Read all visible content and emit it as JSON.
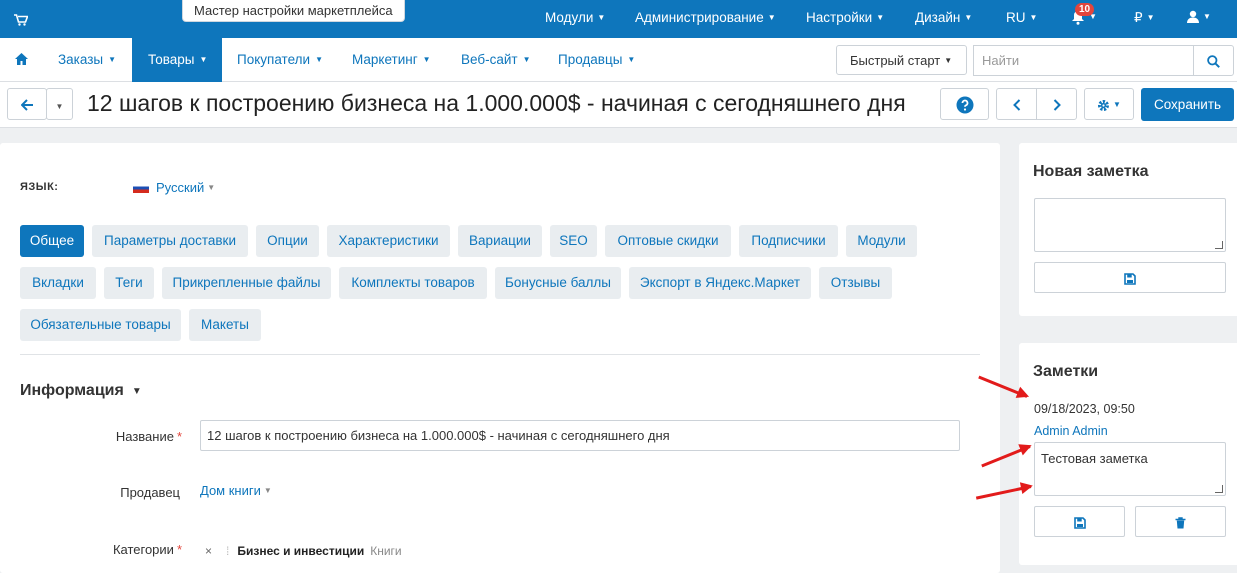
{
  "topbar": {
    "wizard": "Мастер настройки маркетплейса",
    "menus": [
      "Модули",
      "Администрирование",
      "Настройки",
      "Дизайн",
      "RU"
    ],
    "notifications": "10",
    "currency": "₽"
  },
  "nav": {
    "items": [
      "Заказы",
      "Товары",
      "Покупатели",
      "Маркетинг",
      "Веб-сайт",
      "Продавцы"
    ],
    "quick_start": "Быстрый старт",
    "search_placeholder": "Найти"
  },
  "title": {
    "text": "12 шагов к построению бизнеса на 1.000.000$ - начиная с сегодняшнего дня",
    "save": "Сохранить"
  },
  "form": {
    "lang_label": "ЯЗЫК:",
    "lang_value": "Русский",
    "tabs": [
      "Общее",
      "Параметры доставки",
      "Опции",
      "Характеристики",
      "Вариации",
      "SEO",
      "Оптовые скидки",
      "Подписчики",
      "Модули",
      "Вкладки",
      "Теги",
      "Прикрепленные файлы",
      "Комплекты товаров",
      "Бонусные баллы",
      "Экспорт в Яндекс.Маркет",
      "Отзывы",
      "Обязательные товары",
      "Макеты"
    ],
    "section": "Информация",
    "name_label": "Название",
    "name_value": "12 шагов к построению бизнеса на 1.000.000$ - начиная с сегодняшнего дня",
    "seller_label": "Продавец",
    "seller_value": "Дом книги",
    "categories_label": "Категории",
    "category_main": "Бизнес и инвестиции",
    "category_sub": "Книги"
  },
  "notes": {
    "new_title": "Новая заметка",
    "list_title": "Заметки",
    "date": "09/18/2023, 09:50",
    "author": "Admin Admin",
    "text": "Тестовая заметка"
  },
  "colors": {
    "primary": "#0e76bc",
    "arrow": "#e21b1b",
    "badge": "#e2453c"
  }
}
